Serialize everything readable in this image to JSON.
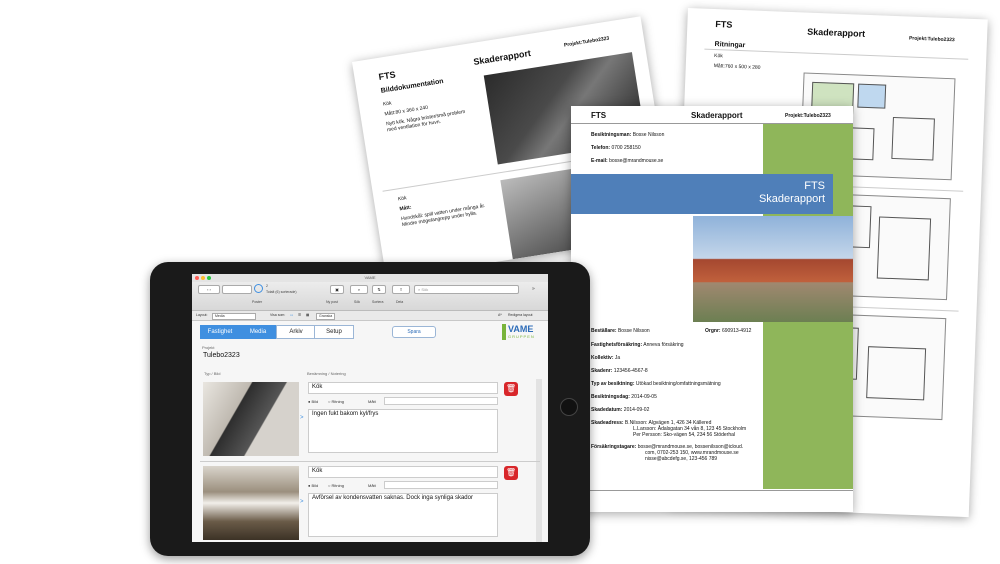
{
  "drawings_doc": {
    "company": "FTS",
    "title": "Skaderapport",
    "project": "Projekt:Tulebo2323",
    "section": "Ritningar",
    "room": "Kök",
    "size": "Mått:760 x 500 x 280"
  },
  "photos_doc": {
    "company": "FTS",
    "title": "Skaderapport",
    "project": "Projekt:Tulebo2323",
    "section": "Bilddokumentation",
    "room1": "Kök",
    "size1": "Mått:80 x 360 x 240",
    "note1": "Nytt kök. Några brister/små problem med ventilation för huvn.",
    "room2": "Kök",
    "size2_label": "Mått:",
    "note2": "Hundskål: spill vatten under många år. Mindre mögelangrepp under hylla."
  },
  "cover_doc": {
    "company": "FTS",
    "title": "Skaderapport",
    "project": "Projekt:Tulebo2323",
    "inspector_label": "Besiktningsman:",
    "inspector": "Bosse Nilsson",
    "phone_label": "Telefon:",
    "phone": "0700 258150",
    "email_label": "E-mail:",
    "email": "bosse@mrandmouse.se",
    "band_line1": "FTS",
    "band_line2": "Skaderapport",
    "orderer_label": "Beställare:",
    "orderer": "Bosse Nilsson",
    "orgnr_label": "Orgnr:",
    "orgnr": "690913-4912",
    "insurance_label": "Fastighetsförsäkring:",
    "insurance": "Anneva försäkring",
    "collective_label": "Kollektiv:",
    "collective": "Ja",
    "claim_label": "Skadenr:",
    "claim": "123456-4567-8",
    "inspection_type_label": "Typ av besiktning:",
    "inspection_type": "Utökad besiktning/omfattningsmätning",
    "inspection_day_label": "Besiktningsdag:",
    "inspection_day": "2014-09-05",
    "damage_date_label": "Skadedatum:",
    "damage_date": "2014-09-02",
    "address_label": "Skadeadress:",
    "address1": "B.Nilsson: Algvägen 1, 426 34 Källered",
    "address2": "L.Larsson: Ådalsgatan 34 vån 8, 123 45 Stockholm",
    "address3": "Per Persson: Sko-vägen 54, 234 56 Stöderhal",
    "contact_label": "Försäkringstagare:",
    "contact1": "bosse@mrandmouse.se, bossenilsson@icloud.",
    "contact2": "com, 0702-253 150, www.mrandmouse.se",
    "contact3": "nisse@abcdefg.se, 123-456 789"
  },
  "app": {
    "window_title": "VAME",
    "record_counter": "2",
    "record_total": "Totalt (6) sorterade)",
    "poster_label": "Poster",
    "new_post": "Ny post",
    "search_label": "Sök",
    "sort_label": "Sortera",
    "share_label": "Dela",
    "search_placeholder": "Sök",
    "layout_label": "Layout:",
    "layout_value": "Media",
    "view_as_label": "Visa som:",
    "preview_label": "Granska",
    "edit_layout": "Redigera layout",
    "tabs": [
      "Fastighet",
      "Media",
      "Arkiv",
      "Setup"
    ],
    "save_button": "Spara",
    "logo_line1": "VAME",
    "logo_line2": "GRUPPEN",
    "project_label": "Projekt",
    "project_value": "Tulebo2323",
    "col_type": "Typ / Bild",
    "col_name": "Benämning / Notering",
    "records": [
      {
        "name": "Kök",
        "radio_image": "Bild",
        "radio_drawing": "Ritning",
        "size_label": "Mått",
        "note": "Ingen fukt bakom kyl/frys",
        "selected": "Bild"
      },
      {
        "name": "Kök",
        "radio_image": "Bild",
        "radio_drawing": "Ritning",
        "size_label": "Mått",
        "note": "Avförsel av kondensvatten saknas. Dock inga synliga skador",
        "selected": "Bild"
      }
    ]
  }
}
